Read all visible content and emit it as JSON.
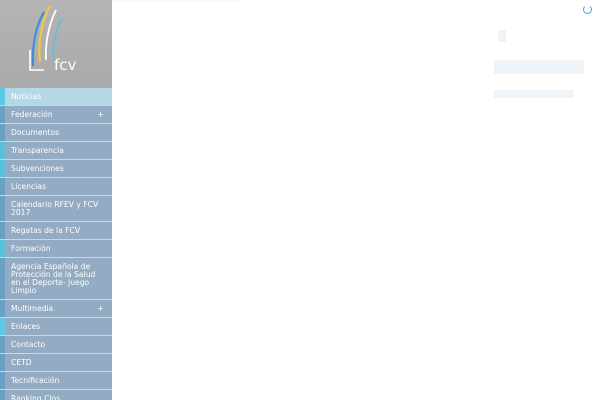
{
  "logo": {
    "text": "fcv"
  },
  "menu": {
    "items": [
      {
        "label": "Noticias",
        "active": true,
        "has_children": false,
        "accent": "#5fc8e6"
      },
      {
        "label": "Federación",
        "active": false,
        "has_children": true,
        "accent": "#6a9fc6"
      },
      {
        "label": "Documentos",
        "active": false,
        "has_children": false,
        "accent": "#6a9fc6"
      },
      {
        "label": "Transparencia",
        "active": false,
        "has_children": false,
        "accent": "#5bbfd8"
      },
      {
        "label": "Subvenciones",
        "active": false,
        "has_children": false,
        "accent": "#5bbfd8"
      },
      {
        "label": "Licencias",
        "active": false,
        "has_children": false,
        "accent": "#6a9fc6"
      },
      {
        "label": "Calendario RFEV y FCV 2017",
        "active": false,
        "has_children": false,
        "accent": "#6a9fc6"
      },
      {
        "label": "Regatas de la FCV",
        "active": false,
        "has_children": false,
        "accent": "#6a9fc6"
      },
      {
        "label": "Formación",
        "active": false,
        "has_children": false,
        "accent": "#5bbfd8"
      },
      {
        "label": "Agencia Española de Protección de la Salud en el Deporte- Juego Limpio",
        "active": false,
        "has_children": false,
        "accent": "#6a9fc6"
      },
      {
        "label": "Multimedia",
        "active": false,
        "has_children": true,
        "accent": "#6a9fc6"
      },
      {
        "label": "Enlaces",
        "active": false,
        "has_children": false,
        "accent": "#5fc8e6"
      },
      {
        "label": "Contacto",
        "active": false,
        "has_children": false,
        "accent": "#6a9fc6"
      },
      {
        "label": "CETD",
        "active": false,
        "has_children": false,
        "accent": "#6a9fc6"
      },
      {
        "label": "Tecnificación",
        "active": false,
        "has_children": false,
        "accent": "#6a9fc6"
      },
      {
        "label": "Ranking Clos",
        "active": false,
        "has_children": false,
        "accent": "#6a9fc6"
      }
    ],
    "expand_symbol": "+"
  }
}
